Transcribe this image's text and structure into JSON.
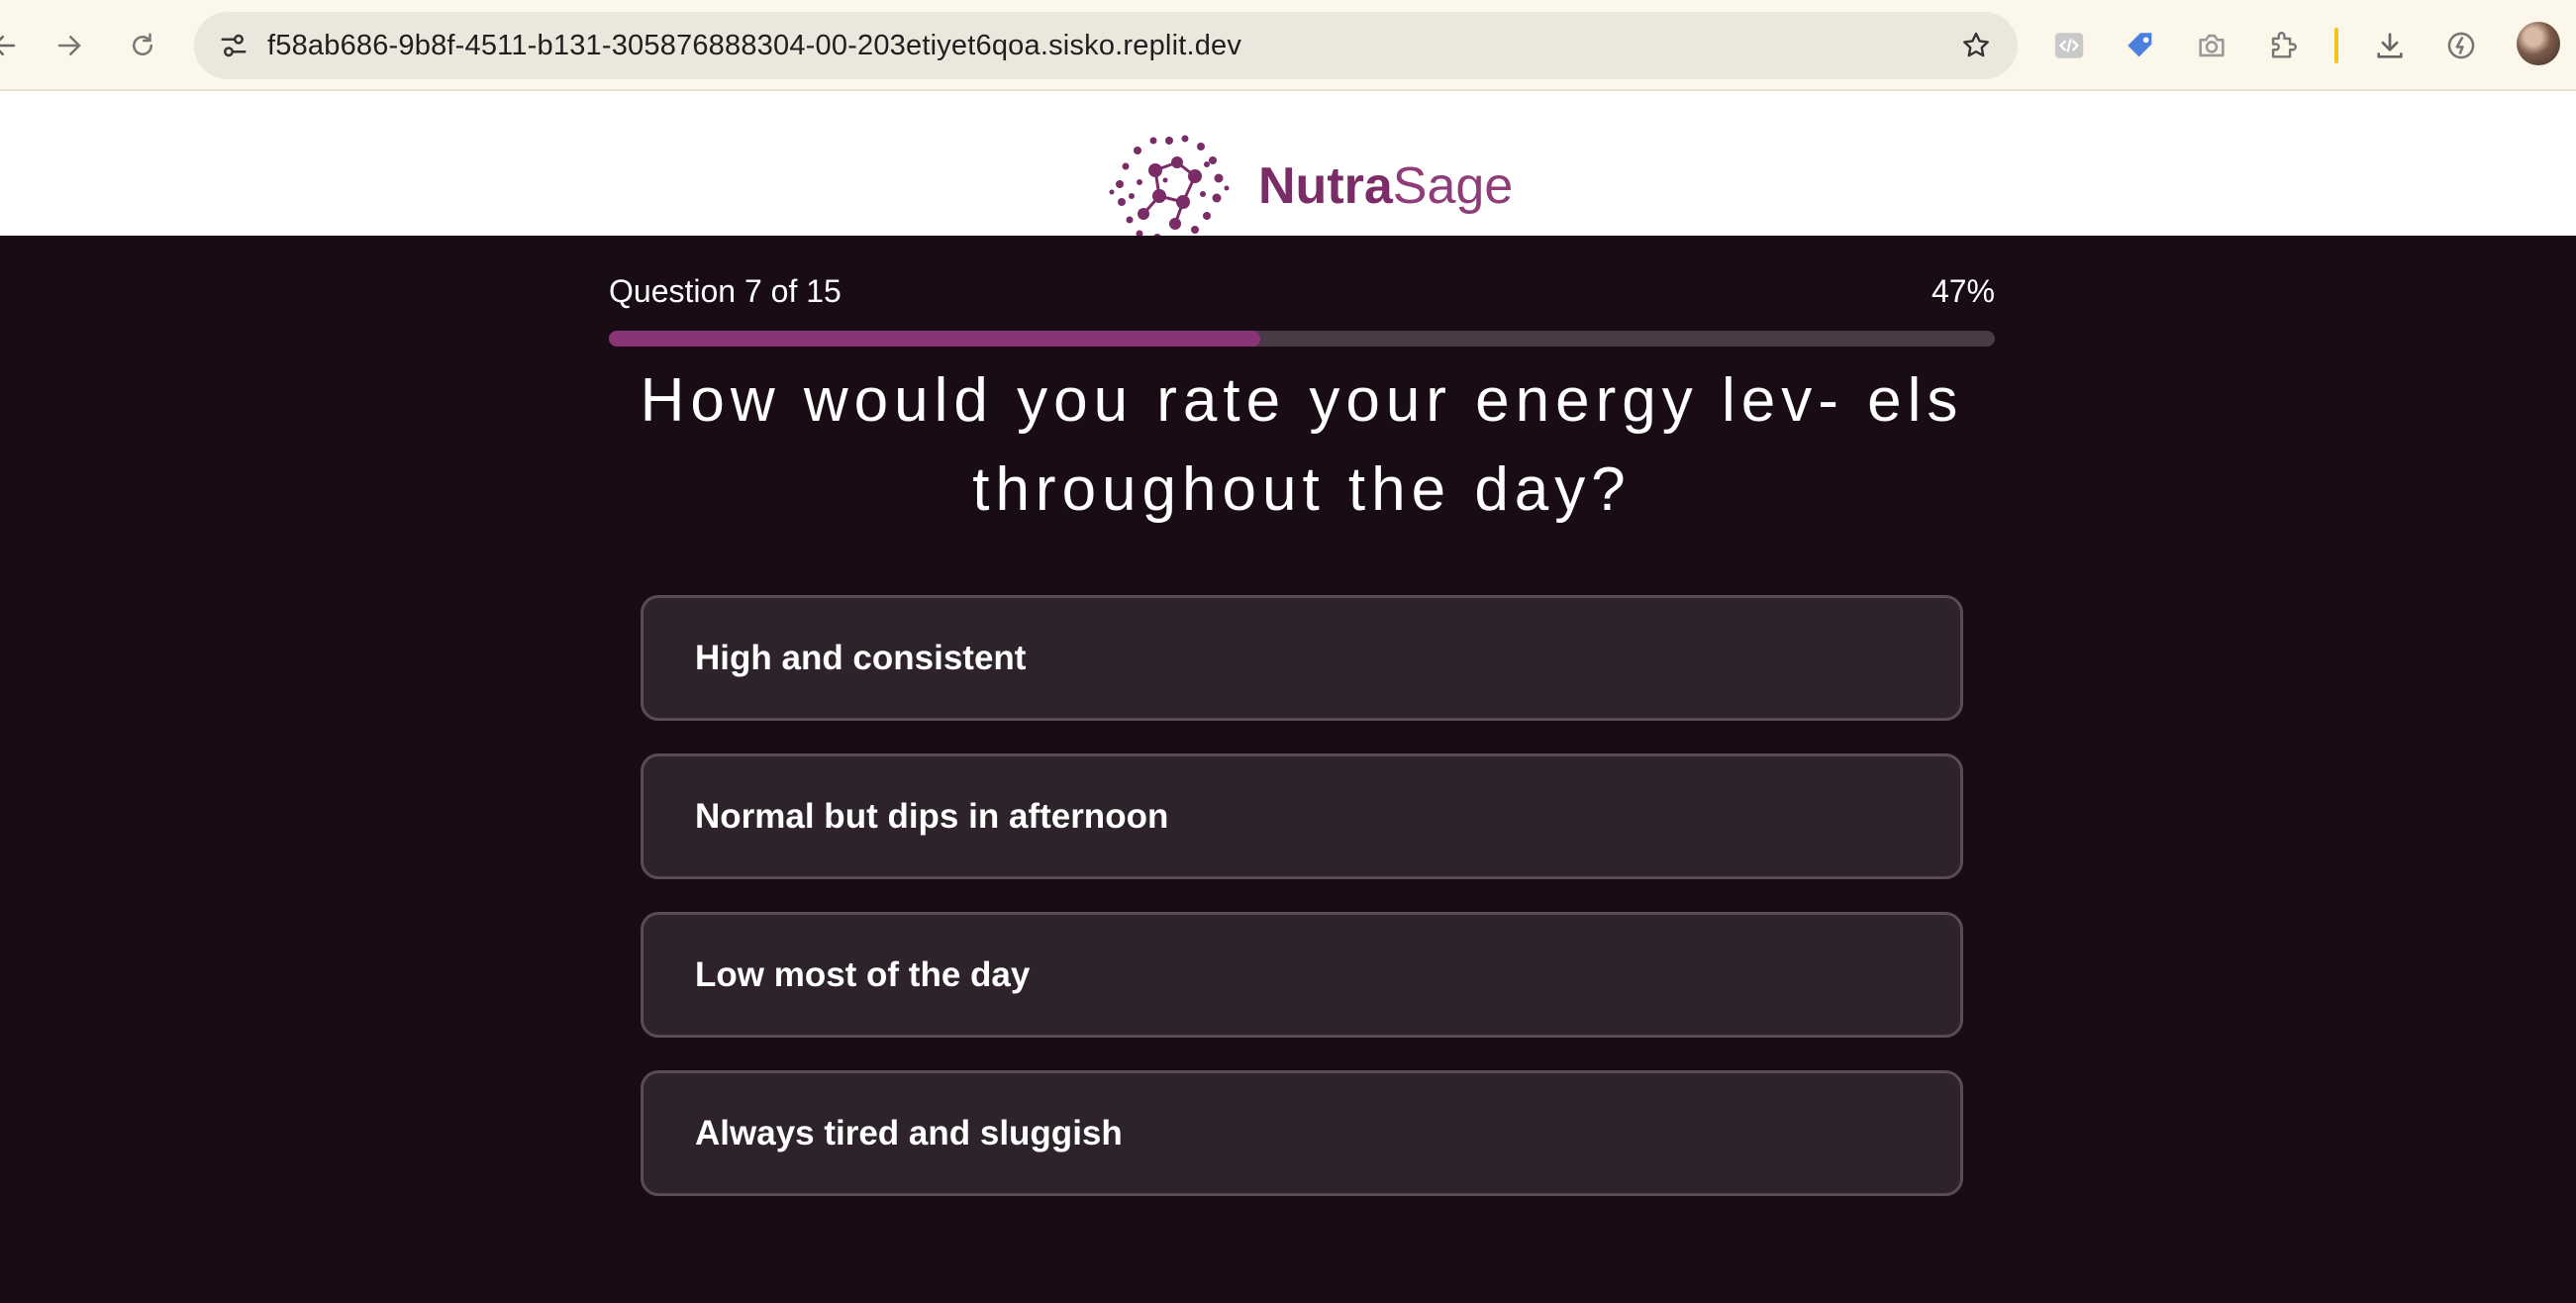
{
  "browser": {
    "url": "f58ab686-9b8f-4511-b131-305876888304-00-203etiyet6qoa.sisko.replit.dev"
  },
  "brand": {
    "name_bold": "Nutra",
    "name_light": "Sage",
    "primary_color": "#7a2c67"
  },
  "quiz": {
    "progress_label": "Question 7 of 15",
    "progress_percent_text": "47%",
    "progress_fraction": 0.47,
    "question": "How would you rate your energy lev- els throughout the day?",
    "options": [
      "High and consistent",
      "Normal but dips in afternoon",
      "Low most of the day",
      "Always tired and sluggish"
    ]
  },
  "colors": {
    "page_background": "#1a0c15",
    "option_background": "#2e222b",
    "progress_fill": "#8a3478",
    "progress_track": "#4a3a45"
  }
}
